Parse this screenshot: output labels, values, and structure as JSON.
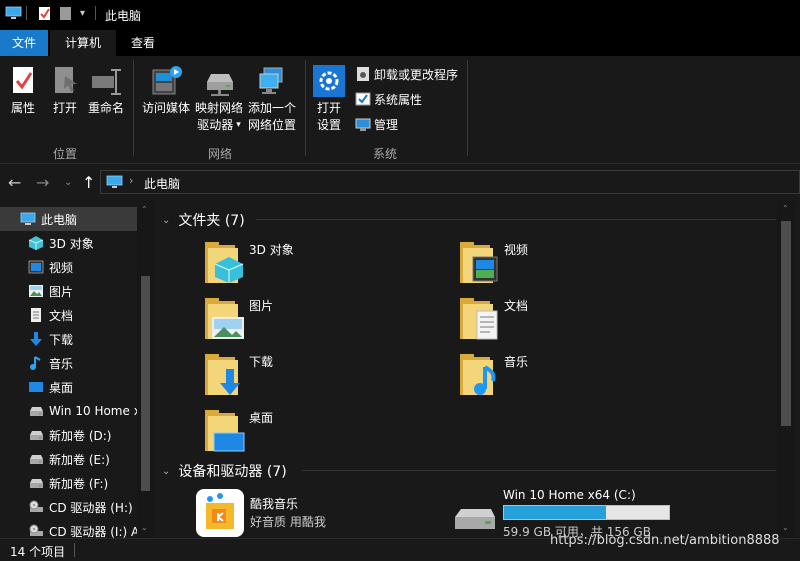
{
  "title_bar": {
    "title": "此电脑"
  },
  "tabs": {
    "file": "文件",
    "computer": "计算机",
    "view": "查看"
  },
  "ribbon": {
    "location": {
      "properties": "属性",
      "open": "打开",
      "rename": "重命名",
      "group": "位置"
    },
    "network": {
      "access_media": "访问媒体",
      "map_drive_1": "映射网络",
      "map_drive_2": "驱动器",
      "add_location_1": "添加一个",
      "add_location_2": "网络位置",
      "group": "网络"
    },
    "system": {
      "open_settings_1": "打开",
      "open_settings_2": "设置",
      "uninstall": "卸载或更改程序",
      "sys_props": "系统属性",
      "manage": "管理",
      "group": "系统"
    }
  },
  "address": {
    "path": "此电脑"
  },
  "nav_pane": {
    "items": [
      {
        "label": "此电脑",
        "icon": "pc-icon"
      },
      {
        "label": "3D 对象",
        "icon": "3d-objects-icon"
      },
      {
        "label": "视频",
        "icon": "video-icon"
      },
      {
        "label": "图片",
        "icon": "pictures-icon"
      },
      {
        "label": "文档",
        "icon": "documents-icon"
      },
      {
        "label": "下载",
        "icon": "downloads-icon"
      },
      {
        "label": "音乐",
        "icon": "music-icon"
      },
      {
        "label": "桌面",
        "icon": "desktop-icon"
      },
      {
        "label": "Win 10 Home x",
        "icon": "drive-icon"
      },
      {
        "label": "新加卷 (D:)",
        "icon": "drive-icon"
      },
      {
        "label": "新加卷 (E:)",
        "icon": "drive-icon"
      },
      {
        "label": "新加卷 (F:)",
        "icon": "drive-icon"
      },
      {
        "label": "CD 驱动器 (H:)",
        "icon": "cd-drive-icon"
      },
      {
        "label": "CD 驱动器 (I:) A",
        "icon": "cd-drive-icon"
      }
    ]
  },
  "content": {
    "folders_header": "文件夹 (7)",
    "folders": [
      {
        "label": "3D 对象",
        "icon": "3d-objects-folder-icon"
      },
      {
        "label": "视频",
        "icon": "video-folder-icon"
      },
      {
        "label": "图片",
        "icon": "pictures-folder-icon"
      },
      {
        "label": "文档",
        "icon": "documents-folder-icon"
      },
      {
        "label": "下载",
        "icon": "downloads-folder-icon"
      },
      {
        "label": "音乐",
        "icon": "music-folder-icon"
      },
      {
        "label": "桌面",
        "icon": "desktop-folder-icon"
      }
    ],
    "devices_header": "设备和驱动器 (7)",
    "devices": [
      {
        "label": "酷我音乐",
        "sub": "好音质 用酷我",
        "icon": "kuwo-music-icon"
      },
      {
        "label": "Win 10 Home x64 (C:)",
        "sub": "59.9 GB 可用，共 156 GB",
        "icon": "drive-icon",
        "used_fraction": 0.62,
        "bar_color": "#26a0da"
      }
    ]
  },
  "status": {
    "count": "14 个项目"
  },
  "watermark": "https://blog.csdn.net/ambition8888",
  "colors": {
    "accent": "#1979ca",
    "selection": "#3a3a3a",
    "drive_bar": "#26a0da"
  }
}
